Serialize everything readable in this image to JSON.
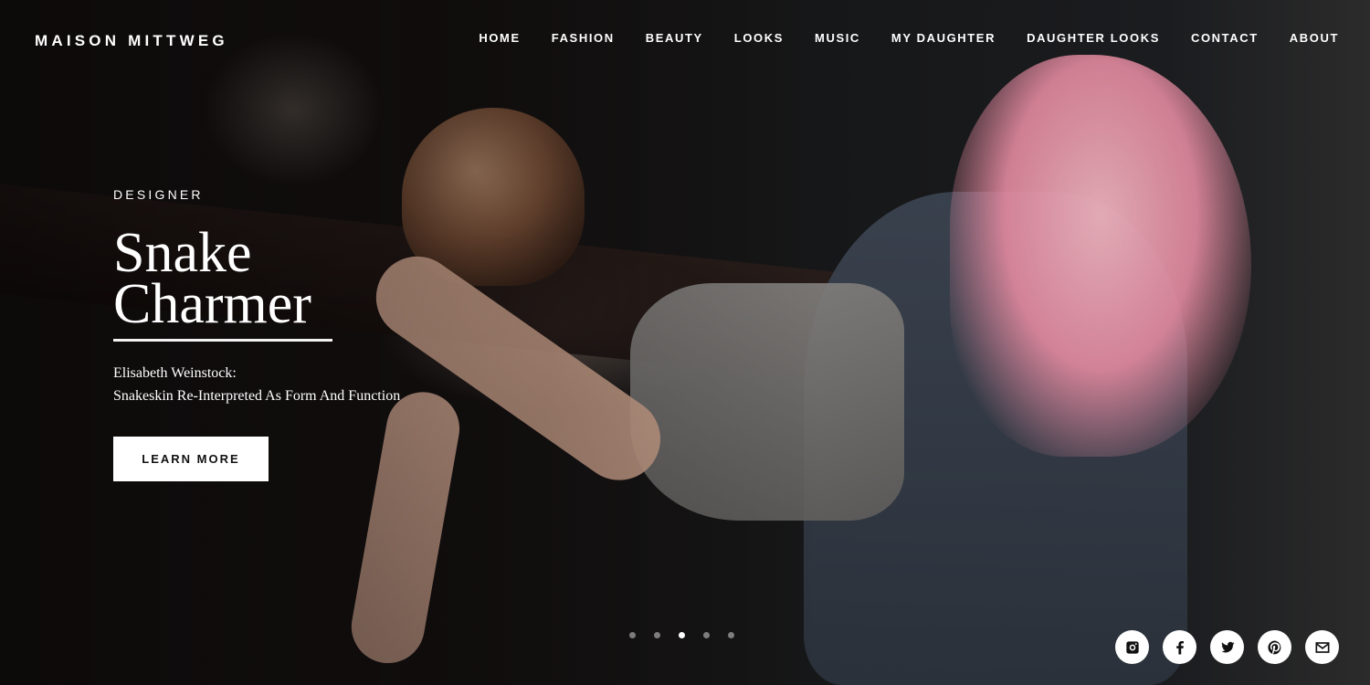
{
  "brand": {
    "name": "MAISON MITTWEG"
  },
  "nav": {
    "items": [
      {
        "label": "HOME"
      },
      {
        "label": "FASHION"
      },
      {
        "label": "BEAUTY"
      },
      {
        "label": "LOOKS"
      },
      {
        "label": "MUSIC"
      },
      {
        "label": "MY DAUGHTER"
      },
      {
        "label": "DAUGHTER LOOKS"
      },
      {
        "label": "CONTACT"
      },
      {
        "label": "ABOUT"
      }
    ]
  },
  "hero": {
    "eyebrow": "DESIGNER",
    "title_line1": "Snake",
    "title_line2": "Charmer",
    "subtitle_line1": "Elisabeth Weinstock:",
    "subtitle_line2": "Snakeskin Re-Interpreted As Form And Function",
    "cta_label": "LEARN MORE"
  },
  "carousel": {
    "slide_count": 5,
    "active_index": 3
  },
  "social": {
    "icons": [
      "instagram-icon",
      "facebook-icon",
      "twitter-icon",
      "pinterest-icon",
      "email-icon"
    ]
  },
  "colors": {
    "text": "#ffffff",
    "button_bg": "#ffffff",
    "button_text": "#111111"
  }
}
